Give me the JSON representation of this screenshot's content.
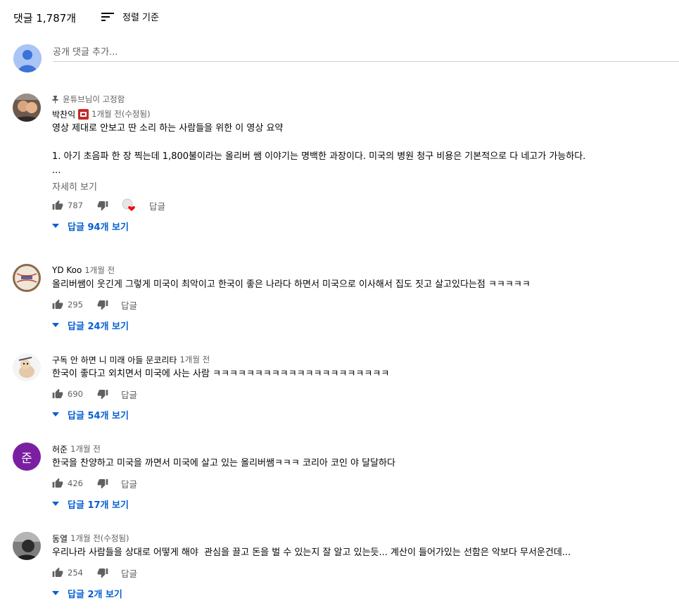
{
  "header": {
    "comment_count": "댓글 1,787개",
    "sort_label": "정렬 기준"
  },
  "add_comment": {
    "placeholder": "공개 댓글 추가..."
  },
  "comments": [
    {
      "pinned_label": "윤튜브님이 고정함",
      "author": "박찬익",
      "time": "1개월 전(수정됨)",
      "text": "영상 제대로 안보고 딴 소리 하는 사람들을 위한 이 영상 요약\n\n1. 아기 초음파 한 장 찍는데 1,800불이라는 올리버 쌤 이야기는 명백한 과장이다. 미국의 병원 청구 비용은 기본적으로 다 네고가 가능하다.\n...",
      "show_more": "자세히 보기",
      "likes": "787",
      "reply_label": "답글",
      "replies_label": "답글 94개 보기"
    },
    {
      "author": "YD Koo",
      "time": "1개월 전",
      "text": "올리버쌤이 웃긴게 그렇게 미국이 최악이고 한국이 좋은 나라다 하면서 미국으로 이사해서 집도 짓고 살고있다는점 ㅋㅋㅋㅋㅋ",
      "likes": "295",
      "reply_label": "답글",
      "replies_label": "답글 24개 보기"
    },
    {
      "author": "구독 안 하면 니 미래 아들 문코리타",
      "time": "1개월 전",
      "text": "한국이 좋다고 외치면서 미국에 사는 사람 ㅋㅋㅋㅋㅋㅋㅋㅋㅋㅋㅋㅋㅋㅋㅋㅋㅋㅋㅋㅋㅋ",
      "likes": "690",
      "reply_label": "답글",
      "replies_label": "답글 54개 보기"
    },
    {
      "author": "허준",
      "avatar_letter": "준",
      "time": "1개월 전",
      "text": "한국을 찬양하고 미국을 까면서 미국에 살고 있는 올리버쌤ㅋㅋㅋ 코리아 코인 야 달달하다",
      "likes": "426",
      "reply_label": "답글",
      "replies_label": "답글 17개 보기"
    },
    {
      "author": "동열",
      "time": "1개월 전(수정됨)",
      "text": "우리나라 사람들을 상대로 어떻게 해야  관심을 끌고 돈을 벌 수 있는지 잘 알고 있는듯... 계산이 들어가있는 선함은 악보다 무서운건데...",
      "likes": "254",
      "reply_label": "답글",
      "replies_label": "답글 2개 보기"
    }
  ],
  "colors": {
    "link_blue": "#065fd4",
    "secondary_text": "#606060",
    "heart_red": "#ff0000",
    "avatar_purple": "#7b1fa2"
  }
}
